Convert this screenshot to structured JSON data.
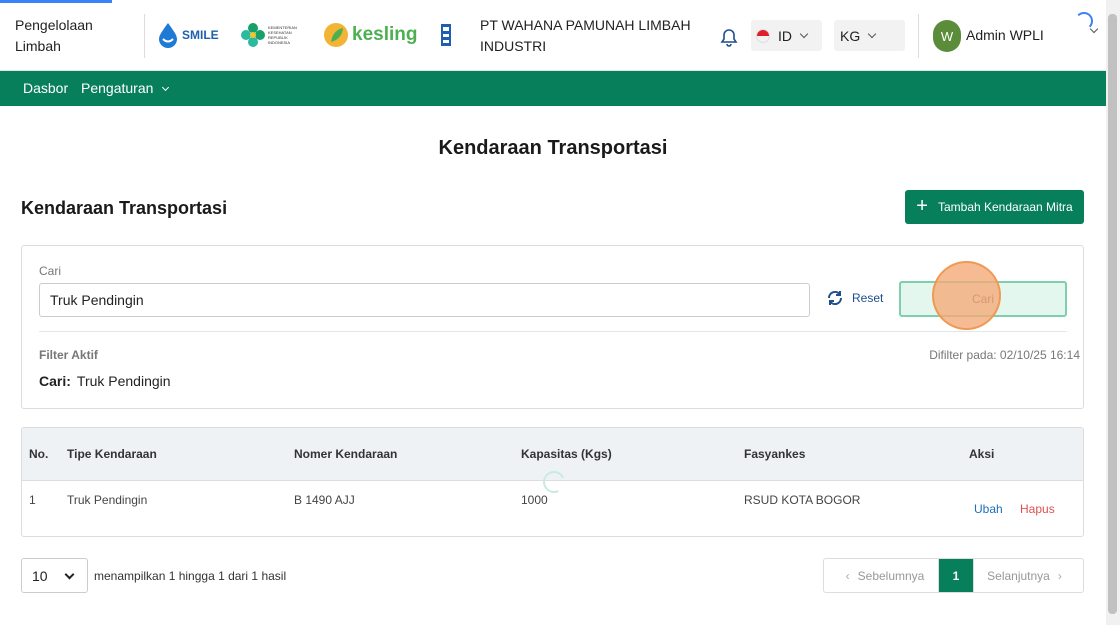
{
  "header": {
    "app_name": "Pengelolaan Limbah",
    "logos": {
      "smile": "SMILE",
      "kemenkes": "KEMENTERIAN KESEHATAN REPUBLIK INDONESIA",
      "kesling": "kesling"
    },
    "company": "PT WAHANA PAMUNAH LIMBAH INDUSTRI",
    "language": "ID",
    "unit": "KG",
    "avatar_initial": "W",
    "user_name": "Admin WPLI",
    "icons": {
      "bell": "bell-icon",
      "flag": "indonesia-flag-icon"
    }
  },
  "nav": {
    "items": [
      {
        "label": "Dasbor"
      },
      {
        "label": "Pengaturan"
      }
    ]
  },
  "page": {
    "title": "Kendaraan Transportasi",
    "section_title": "Kendaraan Transportasi",
    "add_button": "Tambah Kendaraan Mitra"
  },
  "filter": {
    "search_label": "Cari",
    "search_value": "Truk Pendingin",
    "reset_label": "Reset",
    "submit_label": "Cari",
    "active_title": "Filter Aktif",
    "filtered_at": "Difilter pada: 02/10/25 16:14",
    "chip_key": "Cari:",
    "chip_value": "Truk Pendingin"
  },
  "table": {
    "headers": [
      "No.",
      "Tipe Kendaraan",
      "Nomer Kendaraan",
      "Kapasitas (Kgs)",
      "Fasyankes",
      "Aksi"
    ],
    "rows": [
      {
        "no": "1",
        "type": "Truk Pendingin",
        "plate": "B 1490 AJJ",
        "capacity": "1000",
        "facility": "RSUD KOTA BOGOR",
        "edit": "Ubah",
        "delete": "Hapus"
      }
    ]
  },
  "pagination": {
    "page_size": "10",
    "summary": "menampilkan 1 hingga 1 dari 1 hasil",
    "prev": "Sebelumnya",
    "current": "1",
    "next": "Selanjutnya"
  },
  "colors": {
    "primary": "#087f5b",
    "link": "#1f6fb8",
    "danger": "#e05050"
  }
}
